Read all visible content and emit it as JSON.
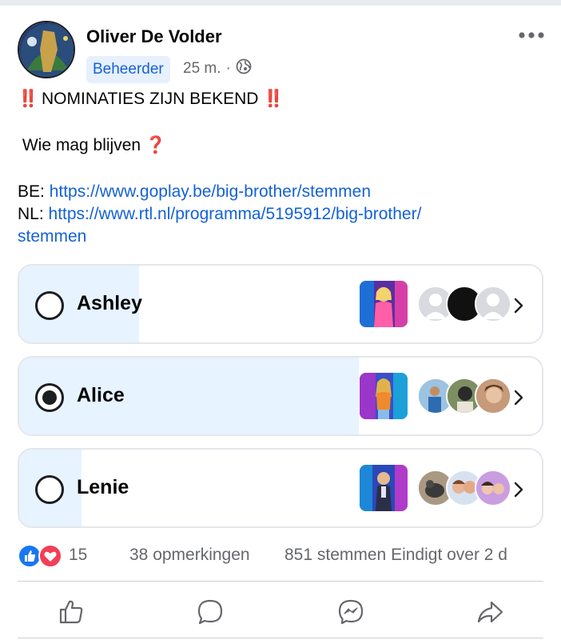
{
  "post": {
    "author": "Oliver De Volder",
    "role_badge": "Beheerder",
    "time": "25 m.",
    "separator": "·",
    "line1_text": "NOMINATIES ZIJN BEKEND",
    "bangs": "‼️",
    "line2_text": "Wie mag blijven",
    "question_mark": "❓",
    "be_prefix": "BE:",
    "be_link": "https://www.goplay.be/big-brother/stemmen",
    "nl_prefix": "NL:",
    "nl_link_line1": "https://www.rtl.nl/programma/5195912/big-brother/",
    "nl_link_line2": "stemmen"
  },
  "poll": {
    "options": [
      {
        "label": "Ashley",
        "selected": false,
        "fill_fraction": 0.23
      },
      {
        "label": "Alice",
        "selected": true,
        "fill_fraction": 0.65
      },
      {
        "label": "Lenie",
        "selected": false,
        "fill_fraction": 0.12
      }
    ]
  },
  "stats": {
    "reaction_count": "15",
    "comments": "38 opmerkingen",
    "votes": "851 stemmen Eindigt over 2 d"
  },
  "colors": {
    "accent": "#1462d6",
    "poll_fill": "#e7f3ff",
    "like": "#1877f2",
    "love": "#f33e58",
    "muted_text": "#65676b"
  },
  "icons": {
    "more": "more-dots-icon",
    "privacy": "globe-icon",
    "like": "like-thumb-icon",
    "comment": "comment-bubble-icon",
    "messenger": "messenger-icon",
    "share": "share-arrow-icon"
  }
}
